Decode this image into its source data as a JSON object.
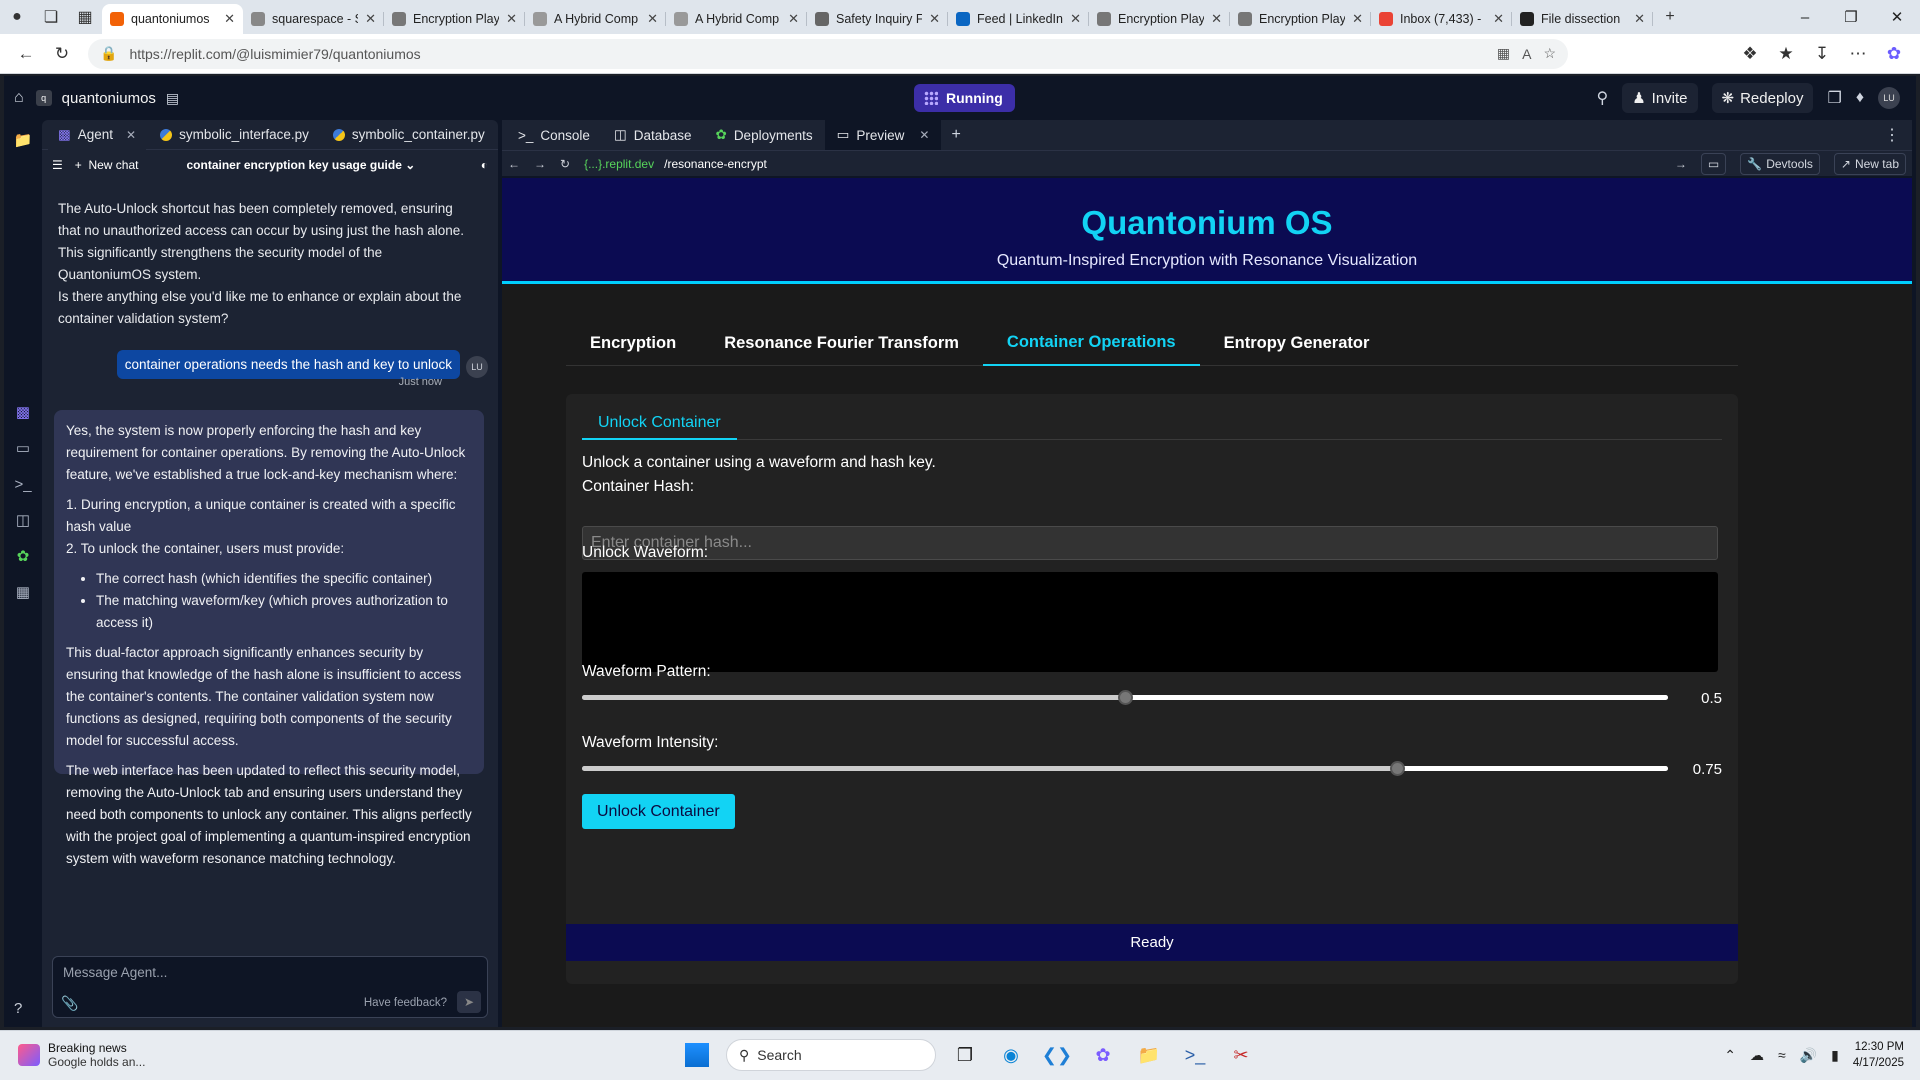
{
  "browser": {
    "tabs": [
      {
        "title": "quantoniumos",
        "fav_color": "#f26207",
        "active": true
      },
      {
        "title": "squarespace - S",
        "fav_color": "#888888"
      },
      {
        "title": "Encryption Play",
        "fav_color": "#777777"
      },
      {
        "title": "A Hybrid Comp",
        "fav_color": "#999999"
      },
      {
        "title": "A Hybrid Comp",
        "fav_color": "#999999"
      },
      {
        "title": "Safety Inquiry F",
        "fav_color": "#666666"
      },
      {
        "title": "Feed | LinkedIn",
        "fav_color": "#0a66c2"
      },
      {
        "title": "Encryption Play",
        "fav_color": "#777777"
      },
      {
        "title": "Encryption Play",
        "fav_color": "#777777"
      },
      {
        "title": "Inbox (7,433) -",
        "fav_color": "#ea4335"
      },
      {
        "title": "File dissection",
        "fav_color": "#222222"
      }
    ],
    "url": "https://replit.com/@luismimier79/quantoniumos"
  },
  "replit": {
    "repl_name": "quantoniumos",
    "run_status": "Running",
    "invite_label": "Invite",
    "redeploy_label": "Redeploy",
    "user_initials": "LU",
    "left_tabs": [
      {
        "label": "Agent"
      },
      {
        "label": "symbolic_interface.py"
      },
      {
        "label": "symbolic_container.py"
      }
    ],
    "new_chat_label": "New chat",
    "chat_title": "container encryption key usage guide",
    "right_tabs": [
      {
        "label": "Console"
      },
      {
        "label": "Database"
      },
      {
        "label": "Deployments"
      },
      {
        "label": "Preview"
      }
    ],
    "preview_domain": "{...}.replit.dev",
    "preview_path": "/resonance-encrypt",
    "devtools_label": "Devtools",
    "new_tab_label": "New tab"
  },
  "chat": {
    "prev_p1": "The Auto-Unlock shortcut has been completely removed, ensuring that no unauthorized access can occur by using just the hash alone. This significantly strengthens the security model of the QuantoniumOS system.",
    "prev_p2": "Is there anything else you'd like me to enhance or explain about the container validation system?",
    "user_message": "container operations needs the hash and key to unlock",
    "user_time": "Just now",
    "agent_p1": "Yes, the system is now properly enforcing the hash and key requirement for container operations. By removing the Auto-Unlock feature, we've established a true lock-and-key mechanism where:",
    "agent_li1": "1. During encryption, a unique container is created with a specific hash value",
    "agent_li2": "2. To unlock the container, users must provide:",
    "agent_sub1": "The correct hash (which identifies the specific container)",
    "agent_sub2": "The matching waveform/key (which proves authorization to access it)",
    "agent_p2": "This dual-factor approach significantly enhances security by ensuring that knowledge of the hash alone is insufficient to access the container's contents. The container validation system now functions as designed, requiring both components of the security model for successful access.",
    "agent_p3": "The web interface has been updated to reflect this security model, removing the Auto-Unlock tab and ensuring users understand they need both components to unlock any container. This aligns perfectly with the project goal of implementing a quantum-inspired encryption system with waveform resonance matching technology.",
    "composer_placeholder": "Message Agent...",
    "feedback_label": "Have feedback?"
  },
  "app": {
    "title": "Quantonium OS",
    "subtitle": "Quantum-Inspired Encryption with Resonance Visualization",
    "tabs": [
      {
        "label": "Encryption"
      },
      {
        "label": "Resonance Fourier Transform"
      },
      {
        "label": "Container Operations",
        "active": true
      },
      {
        "label": "Entropy Generator"
      }
    ],
    "subtab": "Unlock Container",
    "intro": "Unlock a container using a waveform and hash key.",
    "hash_label": "Container Hash:",
    "hash_placeholder": "Enter container hash...",
    "waveform_label": "Unlock Waveform:",
    "pattern_label": "Waveform Pattern:",
    "pattern_value": 0.5,
    "pattern_display": "0.5",
    "intensity_label": "Waveform Intensity:",
    "intensity_value": 0.75,
    "intensity_display": "0.75",
    "unlock_button": "Unlock Container",
    "status": "Ready",
    "accent_color": "#12d3f4",
    "header_bg": "#0b0b52"
  },
  "taskbar": {
    "news_title": "Breaking news",
    "news_sub": "Google holds an...",
    "search_placeholder": "Search",
    "time": "12:30 PM",
    "date": "4/17/2025"
  }
}
